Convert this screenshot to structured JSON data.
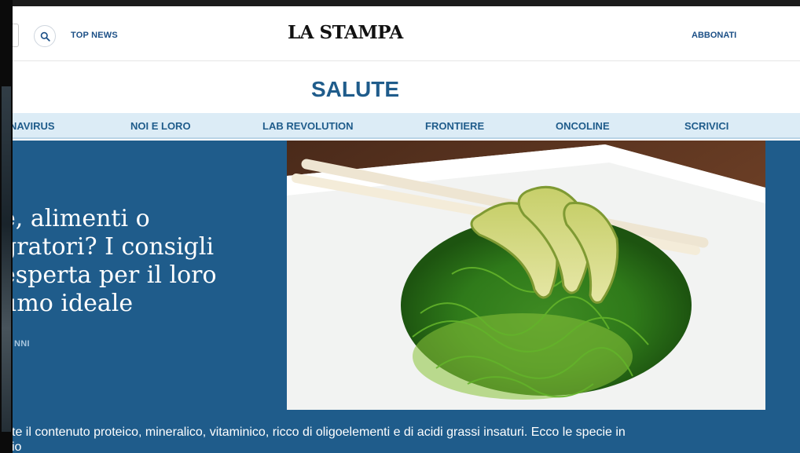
{
  "header": {
    "top_news_label": "TOP NEWS",
    "logo_text": "LA STAMPA",
    "subscribe_label": "ABBONATI",
    "search_icon": "search-icon"
  },
  "section": {
    "title": "SALUTE"
  },
  "nav": {
    "items": [
      {
        "label": "NAVIRUS"
      },
      {
        "label": "NOI E LORO"
      },
      {
        "label": "LAB REVOLUTION"
      },
      {
        "label": "FRONTIERE"
      },
      {
        "label": "ONCOLINE"
      },
      {
        "label": "SCRIVICI"
      }
    ]
  },
  "article": {
    "headline_lines": [
      "e, alimenti o",
      "gratori? I consigli",
      "esperta per il loro",
      "umo ideale"
    ],
    "byline": "NNI",
    "summary_line1": "te il contenuto proteico, mineralico, vitaminico, ricco di oligoelementi e di acidi grassi insaturi. Ecco le specie in",
    "summary_line2": "io"
  },
  "colors": {
    "brand_blue": "#1f5c8b",
    "nav_bg": "#dcecf6",
    "link_blue": "#1b4f86"
  }
}
